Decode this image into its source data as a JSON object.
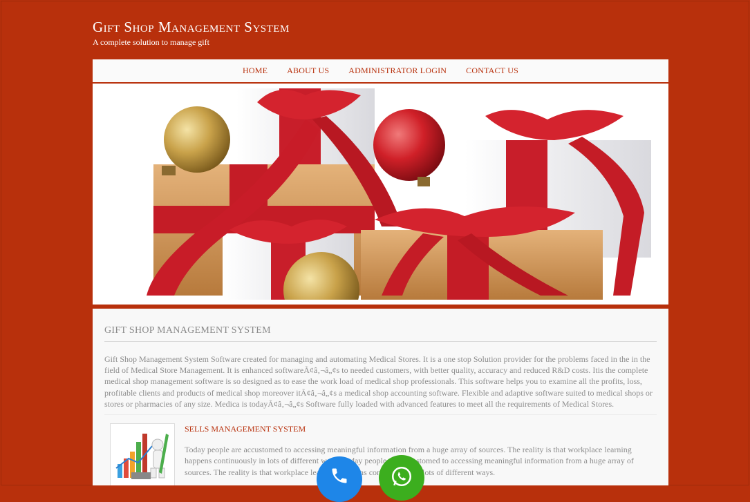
{
  "header": {
    "title": "Gift Shop Management System",
    "tagline": "A complete solution to manage gift"
  },
  "nav": {
    "items": [
      {
        "label": "HOME"
      },
      {
        "label": "ABOUT US"
      },
      {
        "label": "ADMINISTRATOR LOGIN"
      },
      {
        "label": "CONTACT US"
      }
    ]
  },
  "colors": {
    "brand": "#b8300c",
    "nav_background": "#fafafa",
    "content_background": "#f8f8f8",
    "call_button": "#1e86e8",
    "whatsapp_button": "#3cae1e"
  },
  "banner": {
    "image_description_icon": "gift-boxes-banner"
  },
  "main": {
    "heading": "GIFT SHOP MANAGEMENT SYSTEM",
    "intro": "Gift Shop Management System Software created for managing and automating Medical Stores. It is a one stop Solution provider for the problems faced in the in the field of Medical Store Management. It is enhanced softwareÃ¢â‚¬â„¢s to needed customers, with better quality, accuracy and reduced R&D costs. Itis the complete medical shop management software is so designed as to ease the work load of medical shop professionals. This software helps you to examine all the profits, loss, profitable clients and products of medical shop moreover itÃ¢â‚¬â„¢s a medical shop accounting software. Flexible and adaptive software suited to medical shops or stores or pharmacies of any size. Medica is todayÃ¢â‚¬â„¢s Software fully loaded with advanced features to meet all the requirements of Medical Stores.",
    "features": [
      {
        "title": "SELLS MANAGEMENT SYSTEM",
        "text": "Today people are accustomed to accessing meaningful information from a huge array of sources. The reality is that workplace learning happens continuously in lots of different ways. Today people are accustomed to accessing meaningful information from a huge array of sources. The reality is that workplace learning happens continuously in lots of different ways.",
        "icon": "sales-chart-icon"
      }
    ]
  },
  "floating": {
    "call_icon": "phone-icon",
    "whatsapp_icon": "whatsapp-icon"
  }
}
